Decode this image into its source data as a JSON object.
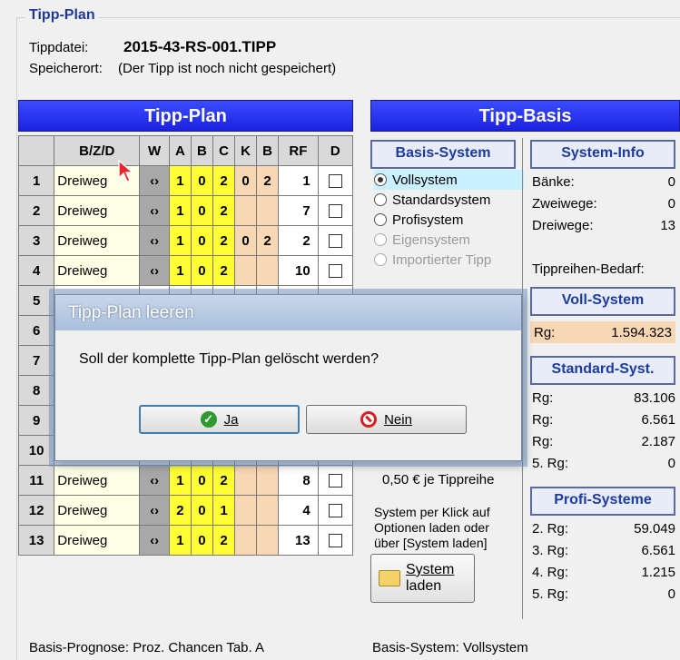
{
  "group_title": "Tipp-Plan",
  "file": {
    "label": "Tippdatei:",
    "value": "2015-43-RS-001.TIPP"
  },
  "location": {
    "label": "Speicherort:",
    "value": "(Der Tipp ist noch nicht gespeichert)"
  },
  "plan": {
    "banner": "Tipp-Plan",
    "headers": [
      "",
      "B/Z/D",
      "W",
      "A",
      "B",
      "C",
      "K",
      "B",
      "RF",
      "D"
    ],
    "rows": [
      {
        "n": "1",
        "type": "Dreiweg",
        "a": "1",
        "b": "0",
        "c": "2",
        "k": "0",
        "kb": "2",
        "rf": "1"
      },
      {
        "n": "2",
        "type": "Dreiweg",
        "a": "1",
        "b": "0",
        "c": "2",
        "k": "",
        "kb": "",
        "rf": "7"
      },
      {
        "n": "3",
        "type": "Dreiweg",
        "a": "1",
        "b": "0",
        "c": "2",
        "k": "0",
        "kb": "2",
        "rf": "2"
      },
      {
        "n": "4",
        "type": "Dreiweg",
        "a": "1",
        "b": "0",
        "c": "2",
        "k": "",
        "kb": "",
        "rf": "10"
      },
      {
        "n": "5"
      },
      {
        "n": "6"
      },
      {
        "n": "7"
      },
      {
        "n": "8"
      },
      {
        "n": "9"
      },
      {
        "n": "10"
      },
      {
        "n": "11",
        "type": "Dreiweg",
        "a": "1",
        "b": "0",
        "c": "2",
        "k": "",
        "kb": "",
        "rf": "8"
      },
      {
        "n": "12",
        "type": "Dreiweg",
        "a": "2",
        "b": "0",
        "c": "1",
        "k": "",
        "kb": "",
        "rf": "4"
      },
      {
        "n": "13",
        "type": "Dreiweg",
        "a": "1",
        "b": "0",
        "c": "2",
        "k": "",
        "kb": "",
        "rf": "13"
      }
    ]
  },
  "basis": {
    "banner": "Tipp-Basis",
    "system_btn": "Basis-System",
    "options": [
      {
        "label": "Vollsystem",
        "selected": true,
        "enabled": true
      },
      {
        "label": "Standardsystem",
        "selected": false,
        "enabled": true
      },
      {
        "label": "Profisystem",
        "selected": false,
        "enabled": true
      },
      {
        "label": "Eigensystem",
        "selected": false,
        "enabled": false
      },
      {
        "label": "Importierter Tipp",
        "selected": false,
        "enabled": false
      }
    ],
    "price": "0,50 € je Tippreihe",
    "hint": [
      "System per Klick auf",
      "Optionen laden oder",
      "über [System laden]"
    ],
    "load_btn": [
      "System",
      "laden"
    ]
  },
  "info": {
    "header": "System-Info",
    "baenke": {
      "label": "Bänke:",
      "value": "0"
    },
    "zweiwege": {
      "label": "Zweiwege:",
      "value": "0"
    },
    "dreiwege": {
      "label": "Dreiwege:",
      "value": "13"
    },
    "bedarf": "Tippreihen-Bedarf:",
    "voll": {
      "header": "Voll-System",
      "rg_label": "Rg:",
      "rg_value": "1.594.323"
    },
    "standard": {
      "header": "Standard-Syst.",
      "rows": [
        {
          "l": "Rg:",
          "v": "83.106"
        },
        {
          "l": "Rg:",
          "v": "6.561"
        },
        {
          "l": "Rg:",
          "v": "2.187"
        },
        {
          "l": "5. Rg:",
          "v": "0"
        }
      ]
    },
    "profi": {
      "header": "Profi-Systeme",
      "rows": [
        {
          "l": "2. Rg:",
          "v": "59.049"
        },
        {
          "l": "3. Rg:",
          "v": "6.561"
        },
        {
          "l": "4. Rg:",
          "v": "1.215"
        },
        {
          "l": "5. Rg:",
          "v": "0"
        }
      ]
    }
  },
  "footer": {
    "left": "Basis-Prognose: Proz. Chancen Tab. A",
    "right": "Basis-System: Vollsystem"
  },
  "dialog": {
    "title": "Tipp-Plan leeren",
    "message": "Soll der komplette Tipp-Plan gelöscht werden?",
    "yes": "Ja",
    "no": "Nein"
  }
}
